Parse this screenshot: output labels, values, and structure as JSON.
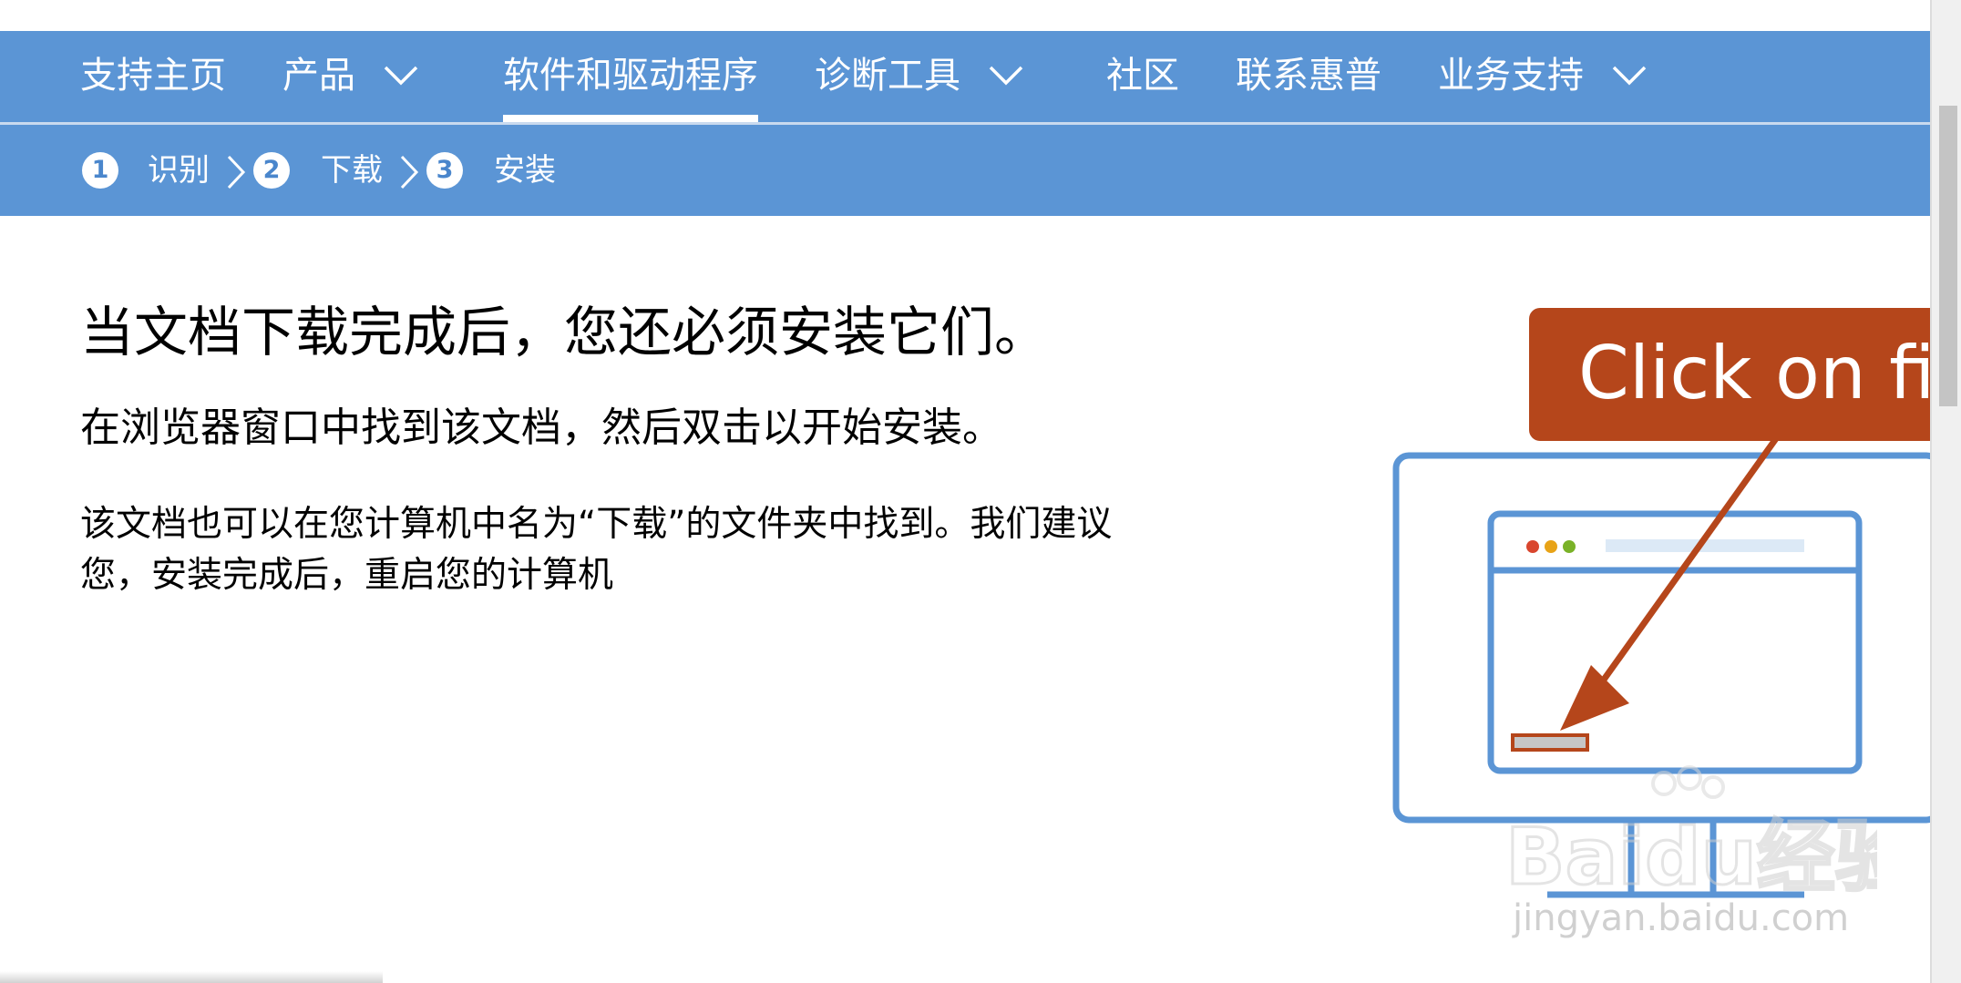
{
  "nav": {
    "items": [
      {
        "label": "支持主页"
      },
      {
        "label": "产品"
      },
      {
        "label": "软件和驱动程序"
      },
      {
        "label": "诊断工具"
      },
      {
        "label": "社区"
      },
      {
        "label": "联系惠普"
      },
      {
        "label": "业务支持"
      }
    ],
    "active_item": "软件和驱动程序"
  },
  "steps": [
    {
      "number": "1",
      "label": "识别"
    },
    {
      "number": "2",
      "label": "下载"
    },
    {
      "number": "3",
      "label": "安装"
    }
  ],
  "content": {
    "headline": "当文档下载完成后，您还必须安装它们。",
    "subheading": "在浏览器窗口中找到该文档，然后双击以开始安装。",
    "paragraph": "该文档也可以在您计算机中名为“下载”的文件夹中找到。我们建议您，安装完成后，重启您的计算机"
  },
  "illustration": {
    "callout_text": "Click on file",
    "colors": {
      "monitor": "#5b95d5",
      "callout": "#b5461b",
      "dot_red": "#d9462e",
      "dot_yellow": "#e8a317",
      "dot_green": "#7ab228"
    }
  },
  "watermark": {
    "brand": "Baidu经验",
    "url": "jingyan.baidu.com"
  },
  "colors": {
    "nav_bg": "#5b95d5",
    "text": "#000000"
  }
}
